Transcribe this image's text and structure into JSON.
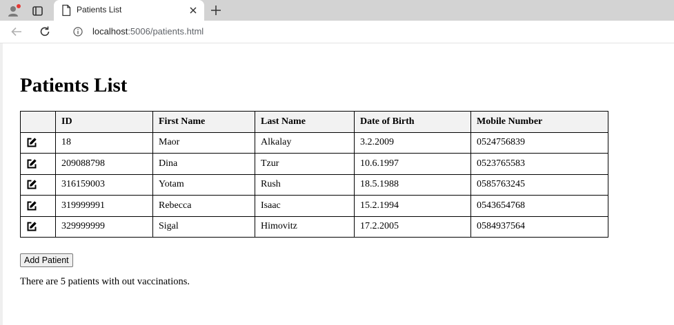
{
  "browser": {
    "tab": {
      "title": "Patients List"
    },
    "address": {
      "host": "localhost",
      "rest": ":5006/patients.html"
    }
  },
  "page": {
    "title": "Patients List",
    "table": {
      "headers": [
        "",
        "ID",
        "First Name",
        "Last Name",
        "Date of Birth",
        "Mobile Number"
      ],
      "rows": [
        {
          "id": "18",
          "first_name": "Maor",
          "last_name": "Alkalay",
          "dob": "3.2.2009",
          "mobile": "0524756839"
        },
        {
          "id": "209088798",
          "first_name": "Dina",
          "last_name": "Tzur",
          "dob": "10.6.1997",
          "mobile": "0523765583"
        },
        {
          "id": "316159003",
          "first_name": "Yotam",
          "last_name": "Rush",
          "dob": "18.5.1988",
          "mobile": "0585763245"
        },
        {
          "id": "319999991",
          "first_name": "Rebecca",
          "last_name": "Isaac",
          "dob": "15.2.1994",
          "mobile": "0543654768"
        },
        {
          "id": "329999999",
          "first_name": "Sigal",
          "last_name": "Himovitz",
          "dob": "17.2.2005",
          "mobile": "0584937564"
        }
      ],
      "row_action_icon": "edit-icon"
    },
    "add_button_label": "Add Patient",
    "status_message": "There are 5 patients with out vaccinations."
  },
  "colors": {
    "tabstrip_bg": "#d3d3d3",
    "header_bg": "#f2f2f2",
    "profile_dot": "#e53935"
  },
  "icons": [
    "profile-icon",
    "tab-actions-icon",
    "page-icon",
    "close-icon",
    "plus-icon",
    "back-arrow-icon",
    "reload-icon",
    "info-icon",
    "edit-icon"
  ]
}
